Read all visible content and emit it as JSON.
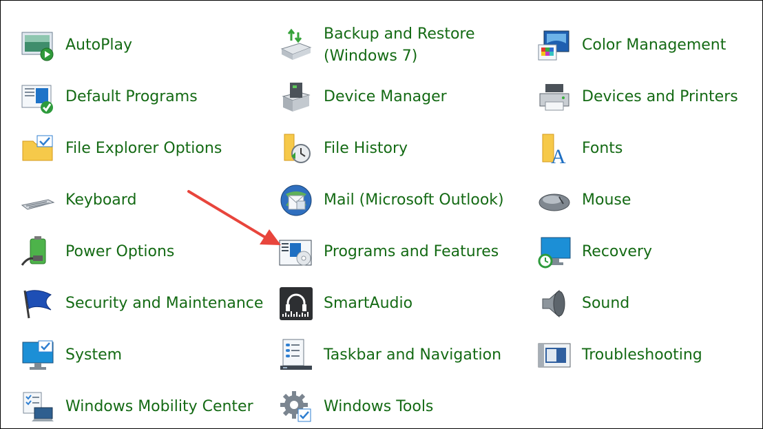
{
  "items": [
    {
      "label": "AutoPlay",
      "icon": "autoplay-icon"
    },
    {
      "label": "Backup and Restore\n(Windows 7)",
      "icon": "backup-restore-icon"
    },
    {
      "label": "Color Management",
      "icon": "color-management-icon"
    },
    {
      "label": "Default Programs",
      "icon": "default-programs-icon"
    },
    {
      "label": "Device Manager",
      "icon": "device-manager-icon"
    },
    {
      "label": "Devices and Printers",
      "icon": "devices-printers-icon"
    },
    {
      "label": "File Explorer Options",
      "icon": "file-explorer-options-icon"
    },
    {
      "label": "File History",
      "icon": "file-history-icon"
    },
    {
      "label": "Fonts",
      "icon": "fonts-icon"
    },
    {
      "label": "Keyboard",
      "icon": "keyboard-icon"
    },
    {
      "label": "Mail (Microsoft Outlook)",
      "icon": "mail-icon"
    },
    {
      "label": "Mouse",
      "icon": "mouse-icon"
    },
    {
      "label": "Power Options",
      "icon": "power-options-icon"
    },
    {
      "label": "Programs and Features",
      "icon": "programs-features-icon"
    },
    {
      "label": "Recovery",
      "icon": "recovery-icon"
    },
    {
      "label": "Security and Maintenance",
      "icon": "security-flag-icon"
    },
    {
      "label": "SmartAudio",
      "icon": "smartaudio-icon"
    },
    {
      "label": "Sound",
      "icon": "speaker-icon"
    },
    {
      "label": "System",
      "icon": "system-monitor-icon"
    },
    {
      "label": "Taskbar and Navigation",
      "icon": "taskbar-icon"
    },
    {
      "label": "Troubleshooting",
      "icon": "troubleshooting-icon"
    },
    {
      "label": "Windows Mobility Center",
      "icon": "mobility-center-icon"
    },
    {
      "label": "Windows Tools",
      "icon": "windows-tools-icon"
    }
  ],
  "annotation": {
    "icon": "red-arrow-icon",
    "color": "#e8453c"
  },
  "colors": {
    "link": "#146a14",
    "border": "#000000",
    "background": "#ffffff"
  }
}
